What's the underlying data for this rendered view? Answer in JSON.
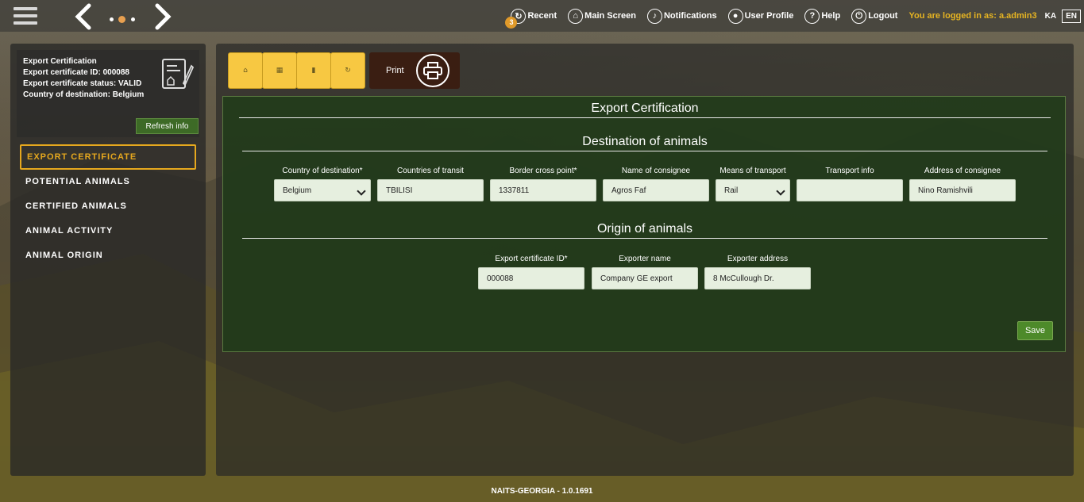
{
  "topbar": {
    "menu": [
      {
        "label": "Recent",
        "icon": "recent-icon",
        "badge": "3"
      },
      {
        "label": "Main Screen",
        "icon": "home-icon"
      },
      {
        "label": "Notifications",
        "icon": "bell-icon"
      },
      {
        "label": "User Profile",
        "icon": "user-icon"
      },
      {
        "label": "Help",
        "icon": "help-icon"
      },
      {
        "label": "Logout",
        "icon": "power-icon"
      }
    ],
    "logged_in": "You are logged in as: a.admin3",
    "lang_ka": "KA",
    "lang_en": "EN"
  },
  "sidebar": {
    "info": {
      "line1": "Export Certification",
      "line2": "Export certificate ID: 000088",
      "line3": "Export certificate status: VALID",
      "line4": "Country of destination: Belgium"
    },
    "refresh_label": "Refresh info",
    "items": [
      {
        "label": "EXPORT CERTIFICATE",
        "active": true
      },
      {
        "label": "POTENTIAL ANIMALS",
        "active": false
      },
      {
        "label": "CERTIFIED ANIMALS",
        "active": false
      },
      {
        "label": "ANIMAL ACTIVITY",
        "active": false
      },
      {
        "label": "ANIMAL ORIGIN",
        "active": false
      }
    ]
  },
  "toolbar": {
    "print_label": "Print"
  },
  "form": {
    "title": "Export Certification",
    "destination_title": "Destination of animals",
    "origin_title": "Origin of animals",
    "fields": {
      "country_dest": {
        "label": "Country of destination*",
        "value": "Belgium"
      },
      "countries_transit": {
        "label": "Countries of transit",
        "value": "TBILISI"
      },
      "border_point": {
        "label": "Border cross point*",
        "value": "1337811"
      },
      "consignee_name": {
        "label": "Name of consignee",
        "value": "Agros Faf"
      },
      "means_transport": {
        "label": "Means of transport",
        "value": "Rail"
      },
      "transport_info": {
        "label": "Transport info",
        "value": ""
      },
      "consignee_address": {
        "label": "Address of consignee",
        "value": "Nino Ramishvili"
      },
      "cert_id": {
        "label": "Export certificate ID*",
        "value": "000088"
      },
      "exporter_name": {
        "label": "Exporter name",
        "value": "Company GE export"
      },
      "exporter_address": {
        "label": "Exporter address",
        "value": "8 McCullough Dr."
      }
    },
    "save_label": "Save"
  },
  "footer": "NAITS-GEORGIA - 1.0.1691",
  "colors": {
    "accent": "#e6a81e",
    "toolbar_yellow": "#f7c842",
    "save_green": "#4d8a2a",
    "form_bg": "#203c18"
  }
}
